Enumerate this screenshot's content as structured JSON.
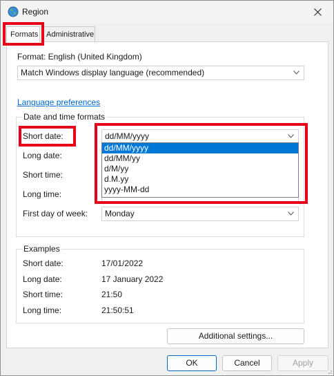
{
  "window": {
    "title": "Region"
  },
  "tabs": [
    {
      "label": "Formats",
      "active": true
    },
    {
      "label": "Administrative",
      "active": false
    }
  ],
  "formats": {
    "format_label": "Format: English (United Kingdom)",
    "format_select_value": "Match Windows display language (recommended)",
    "language_link": "Language preferences"
  },
  "datetime_group": {
    "title": "Date and time formats",
    "rows": [
      {
        "label": "Short date:",
        "value": "dd/MM/yyyy"
      },
      {
        "label": "Long date:",
        "value": ""
      },
      {
        "label": "Short time:",
        "value": ""
      },
      {
        "label": "Long time:",
        "value": ""
      },
      {
        "label": "First day of week:",
        "value": "Monday"
      }
    ],
    "short_date_options": [
      "dd/MM/yyyy",
      "dd/MM/yy",
      "d/M/yy",
      "d.M.yy",
      "yyyy-MM-dd"
    ],
    "selected_option_index": 0
  },
  "examples": {
    "title": "Examples",
    "rows": [
      {
        "label": "Short date:",
        "value": "17/01/2022"
      },
      {
        "label": "Long date:",
        "value": "17 January 2022"
      },
      {
        "label": "Short time:",
        "value": "21:50"
      },
      {
        "label": "Long time:",
        "value": "21:50:51"
      }
    ]
  },
  "buttons": {
    "additional_settings": "Additional settings...",
    "ok": "OK",
    "cancel": "Cancel",
    "apply": "Apply"
  },
  "colors": {
    "highlight": "#e8001a",
    "selection": "#0078d7",
    "link": "#0066cc"
  },
  "icons": {
    "app": "globe-icon",
    "close": "close-icon",
    "dropdown": "chevron-down-icon"
  }
}
